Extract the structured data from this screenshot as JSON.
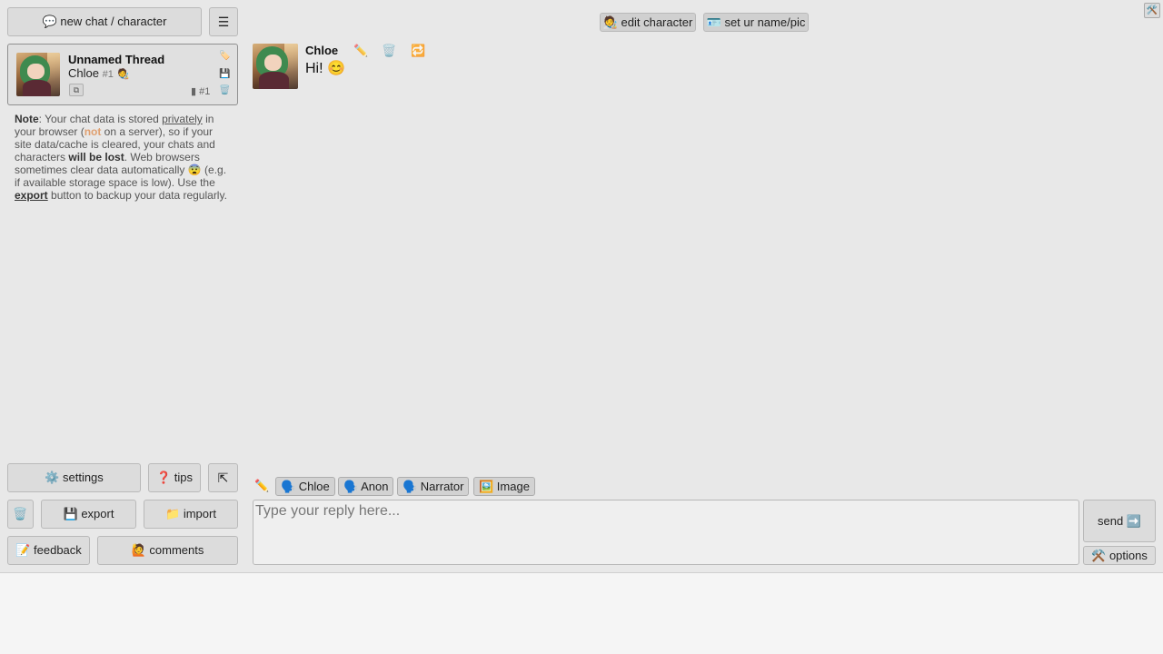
{
  "sidebar": {
    "new_chat_label": "💬 new chat / character",
    "menu_icon": "☰",
    "thread": {
      "title": "Unnamed Thread",
      "character": "Chloe",
      "character_num": "#1",
      "character_icon": "🧑‍🎨",
      "thread_id": "#1",
      "bookmark_icon": "🏷️",
      "save_icon": "💾",
      "delete_icon": "🗑️",
      "duplicate_icon": "⧉",
      "id_icon": "▮"
    },
    "note": {
      "label": "Note",
      "part1": ": Your chat data is stored ",
      "privately": "privately",
      "part2": " in your browser (",
      "not": "not",
      "part3": " on a server), so if your site data/cache is cleared, your chats and characters ",
      "will_be_lost": "will be lost",
      "part4": ". Web browsers sometimes clear data automatically 😨 (e.g. if available storage space is low). Use the ",
      "export": "export",
      "part5": " button to backup your data regularly."
    },
    "bottom": {
      "settings": "⚙️ settings",
      "tips": "❓ tips",
      "collapse_icon": "⇱",
      "delete_icon": "🗑️",
      "export": "💾 export",
      "import": "📁 import",
      "feedback": "📝 feedback",
      "comments": "🙋 comments"
    }
  },
  "header": {
    "edit_character": "🧑‍🎨 edit character",
    "set_name_pic": "🪪 set ur name/pic",
    "corner_icon": "🛠️"
  },
  "chat": {
    "message": {
      "author": "Chloe",
      "text": "Hi! 😊",
      "edit_icon": "✏️",
      "delete_icon": "🗑️",
      "regenerate_icon": "🔁"
    },
    "reply_as": {
      "edit_icon": "✏️",
      "chloe": "🗣️ Chloe",
      "anon": "🗣️ Anon",
      "narrator": "🗣️ Narrator",
      "image": "🖼️ Image"
    },
    "input_placeholder": "Type your reply here...",
    "send": "send ➡️",
    "options": "⚒️ options"
  }
}
